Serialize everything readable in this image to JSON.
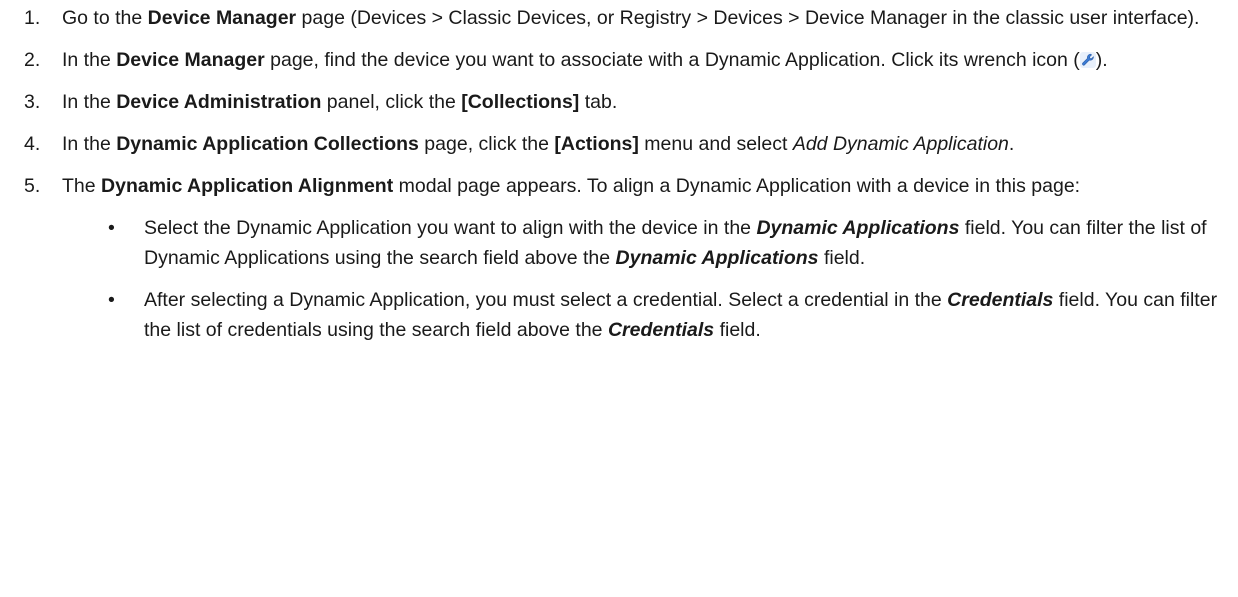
{
  "steps": [
    {
      "num": "1.",
      "t1": "Go to the ",
      "b1": "Device Manager",
      "t2": " page (Devices > Classic Devices, or Registry > Devices > Device Manager in the classic user interface)."
    },
    {
      "num": "2.",
      "t1": "In the ",
      "b1": "Device Manager",
      "t2": " page, find the device you want to associate with a Dynamic Application. Click its wrench icon (",
      "t3": ")."
    },
    {
      "num": "3.",
      "t1": "In the ",
      "b1": "Device Administration",
      "t2": " panel, click the ",
      "b2": "[Collections]",
      "t3": " tab."
    },
    {
      "num": "4.",
      "t1": "In the ",
      "b1": "Dynamic Application Collections",
      "t2": " page, click the ",
      "b2": "[Actions]",
      "t3": " menu and select ",
      "i1": "Add Dynamic Application",
      "t4": "."
    },
    {
      "num": "5.",
      "t1": "The ",
      "b1": "Dynamic Application Alignment",
      "t2": " modal page appears. To align a Dynamic Application with a device in this page:"
    }
  ],
  "bullets": [
    {
      "symbol": "•",
      "t1": "Select the Dynamic Application you want to align with the device in the ",
      "f1": "Dynamic Applications",
      "t2": " field. You can filter the list of Dynamic Applications using the search field above the ",
      "f2": "Dynamic Applications",
      "t3": " field."
    },
    {
      "symbol": "•",
      "t1": "After selecting a Dynamic Application, you must select a credential. Select a credential in the ",
      "f1": "Credentials",
      "t2": " field. You can filter the list of credentials using the search field above the ",
      "f2": "Credentials",
      "t3": " field."
    }
  ],
  "icons": {
    "wrench": "wrench-icon",
    "wrench_color": "#3b7bd4"
  }
}
